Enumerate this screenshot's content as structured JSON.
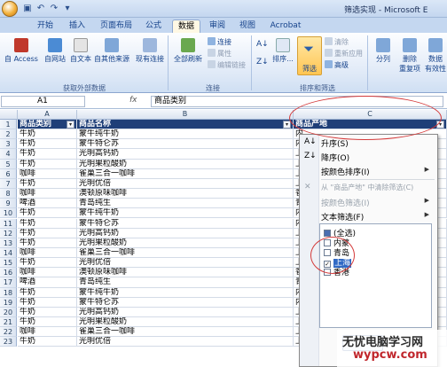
{
  "window": {
    "title": "筛选实现 - Microsoft E"
  },
  "tabs": [
    {
      "label": "开始"
    },
    {
      "label": "插入"
    },
    {
      "label": "页面布局"
    },
    {
      "label": "公式"
    },
    {
      "label": "数据",
      "active": true
    },
    {
      "label": "审阅"
    },
    {
      "label": "视图"
    },
    {
      "label": "Acrobat"
    }
  ],
  "ribbon": {
    "external": {
      "access": "自 Access",
      "web": "自网站",
      "text": "自文本",
      "other": "自其他来源",
      "existing": "现有连接",
      "group_label": "获取外部数据"
    },
    "connections": {
      "refresh_all": "全部刷新",
      "connections": "连接",
      "properties": "属性",
      "edit_links": "编辑链接",
      "group_label": "连接"
    },
    "sort_filter": {
      "sort": "排序...",
      "filter": "筛选",
      "clear": "清除",
      "reapply": "重新应用",
      "advanced": "高级",
      "group_label": "排序和筛选"
    },
    "tools": {
      "split": "分列",
      "remove_dup": "删除",
      "remove_dup2": "重复项",
      "validate": "数据",
      "validate2": "有效性"
    }
  },
  "formula_bar": {
    "cell_ref": "A1",
    "fx": "fx",
    "content": "商品类别"
  },
  "columns": {
    "a": "A",
    "b": "B",
    "c": "C"
  },
  "header_row": {
    "num": "1",
    "a": "商品类别",
    "b": "商品名称",
    "c": "商品产地"
  },
  "rows": [
    {
      "num": "2",
      "a": "牛奶",
      "b": "蒙牛纯牛奶",
      "c": "内"
    },
    {
      "num": "3",
      "a": "牛奶",
      "b": "蒙牛特仑苏",
      "c": "内"
    },
    {
      "num": "4",
      "a": "牛奶",
      "b": "光明高钙奶",
      "c": "上"
    },
    {
      "num": "5",
      "a": "牛奶",
      "b": "光明果粒酸奶",
      "c": "上"
    },
    {
      "num": "6",
      "a": "咖啡",
      "b": "雀巢三合一咖啡",
      "c": "上"
    },
    {
      "num": "7",
      "a": "牛奶",
      "b": "光明优倍",
      "c": "上"
    },
    {
      "num": "8",
      "a": "咖啡",
      "b": "澳顿原味咖啡",
      "c": "香"
    },
    {
      "num": "9",
      "a": "啤酒",
      "b": "青岛纯生",
      "c": "青"
    },
    {
      "num": "10",
      "a": "牛奶",
      "b": "蒙牛纯牛奶",
      "c": "内"
    },
    {
      "num": "11",
      "a": "牛奶",
      "b": "蒙牛特仑苏",
      "c": "内"
    },
    {
      "num": "12",
      "a": "牛奶",
      "b": "光明高钙奶",
      "c": "上"
    },
    {
      "num": "13",
      "a": "牛奶",
      "b": "光明果粒酸奶",
      "c": "上"
    },
    {
      "num": "14",
      "a": "咖啡",
      "b": "雀巢三合一咖啡",
      "c": "上"
    },
    {
      "num": "15",
      "a": "牛奶",
      "b": "光明优倍",
      "c": "上"
    },
    {
      "num": "16",
      "a": "咖啡",
      "b": "澳顿原味咖啡",
      "c": "香"
    },
    {
      "num": "17",
      "a": "啤酒",
      "b": "青岛纯生",
      "c": "青"
    },
    {
      "num": "18",
      "a": "牛奶",
      "b": "蒙牛纯牛奶",
      "c": "内"
    },
    {
      "num": "19",
      "a": "牛奶",
      "b": "蒙牛特仑苏",
      "c": "内"
    },
    {
      "num": "20",
      "a": "牛奶",
      "b": "光明高钙奶",
      "c": "上"
    },
    {
      "num": "21",
      "a": "牛奶",
      "b": "光明果粒酸奶",
      "c": "上"
    },
    {
      "num": "22",
      "a": "咖啡",
      "b": "雀巢三合一咖啡",
      "c": "上"
    },
    {
      "num": "23",
      "a": "牛奶",
      "b": "光明优倍",
      "c": "上海"
    }
  ],
  "filter_menu": {
    "sort_asc": "升序(S)",
    "sort_desc": "降序(O)",
    "sort_by_color": "按颜色排序(I)",
    "clear_filter": "从 \"商品产地\" 中清除筛选(C)",
    "filter_by_color": "按颜色筛选(I)",
    "text_filter": "文本筛选(F)",
    "options": [
      {
        "label": "(全选)",
        "state": "partial"
      },
      {
        "label": "内蒙",
        "state": "unchecked"
      },
      {
        "label": "青岛",
        "state": "unchecked"
      },
      {
        "label": "上海",
        "state": "checked",
        "highlight": true
      },
      {
        "label": "香港",
        "state": "unchecked"
      }
    ]
  },
  "watermark": {
    "cn": "无忧电脑学习网",
    "en": "wypcw.com"
  },
  "colors": {
    "header_fill": "#1f3f78",
    "oval": "#d43a3a",
    "selection": "#316ac5"
  }
}
